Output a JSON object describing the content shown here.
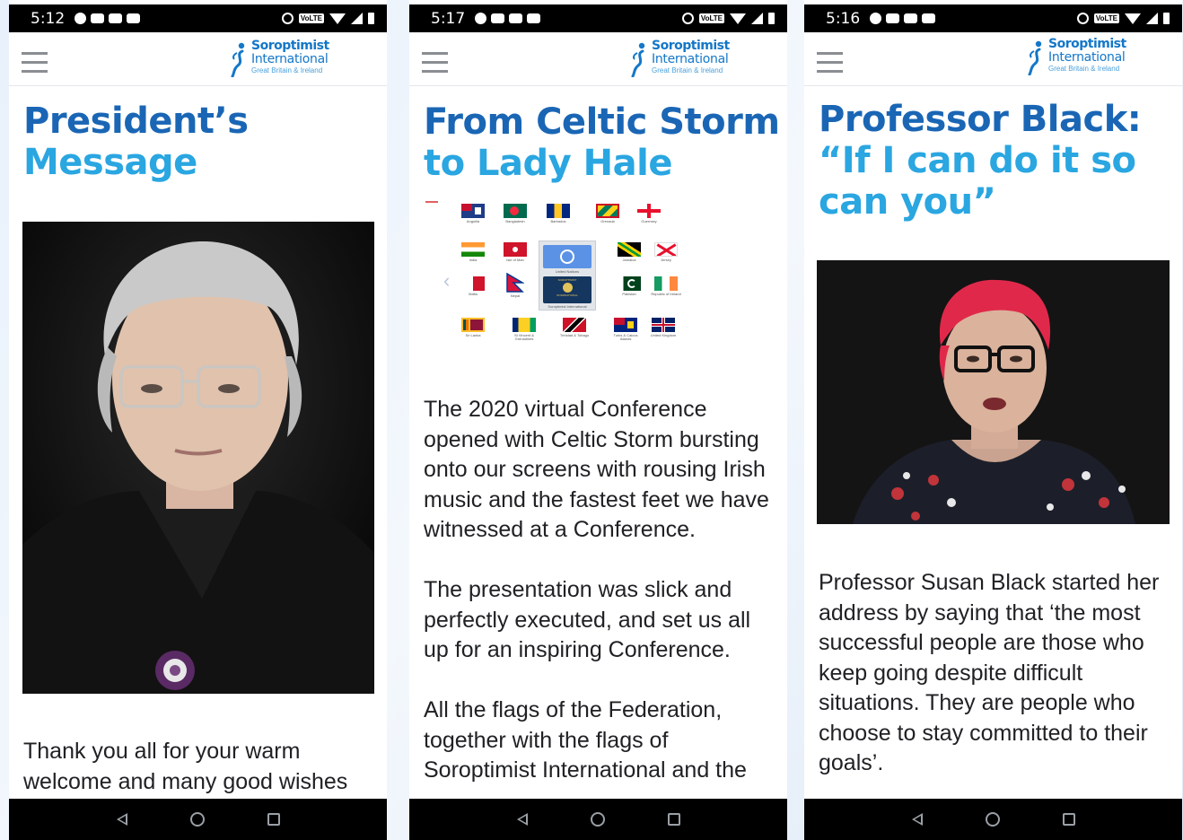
{
  "logo": {
    "name": "Soroptimist",
    "line2": "International",
    "region": "Great Britain & Ireland"
  },
  "phones": [
    {
      "time": "5:12",
      "title_lines": [
        "President’s",
        "Message"
      ],
      "body": [
        "Thank you all for your warm welcome and many good wishes"
      ]
    },
    {
      "time": "5:17",
      "title_lines": [
        "From Celtic Storm",
        "to Lady Hale"
      ],
      "flags": [
        "Anguilla",
        "Bangladesh",
        "Barbados",
        "Grenada",
        "Guernsey",
        "India",
        "Isle of Man",
        "Jamaica",
        "Jersey",
        "Malta",
        "Nepal",
        "Pakistan",
        "Republic of Ireland",
        "Sri Lanka",
        "St Vincent & Grenadines",
        "Trinidad & Tobago",
        "Turks & Caicos Islands",
        "United Kingdom"
      ],
      "center_card": {
        "top_label": "United Nations",
        "bottom_label": "Soroptimist International",
        "emblem_lines": [
          "SOROPTIMIST",
          "INTERNATIONAL"
        ]
      },
      "body": [
        "The 2020 virtual Conference opened with Celtic Storm bursting onto our screens with rousing Irish music and the fastest feet we have witnessed at a Conference.",
        "The presentation was slick and perfectly executed, and set us all up for an inspiring Conference.",
        "All the flags of the Federation, together with the flags of Soroptimist International and the"
      ]
    },
    {
      "time": "5:16",
      "title_lines": [
        "Professor Black:",
        "“If I can do it so",
        "can you”"
      ],
      "body": [
        "Professor Susan Black started her address by saying that ‘the most successful people are those who keep going despite difficult situations. They are people who choose to stay committed to their goals’."
      ]
    }
  ],
  "status": {
    "volte": "VoLTE"
  },
  "colors": {
    "title_dark": "#1a66b5",
    "title_light": "#2aa6e1",
    "logo": "#1477c8"
  },
  "icons": {
    "menu": "hamburger-icon",
    "back": "back-icon",
    "home": "home-icon",
    "recents": "recents-icon"
  }
}
